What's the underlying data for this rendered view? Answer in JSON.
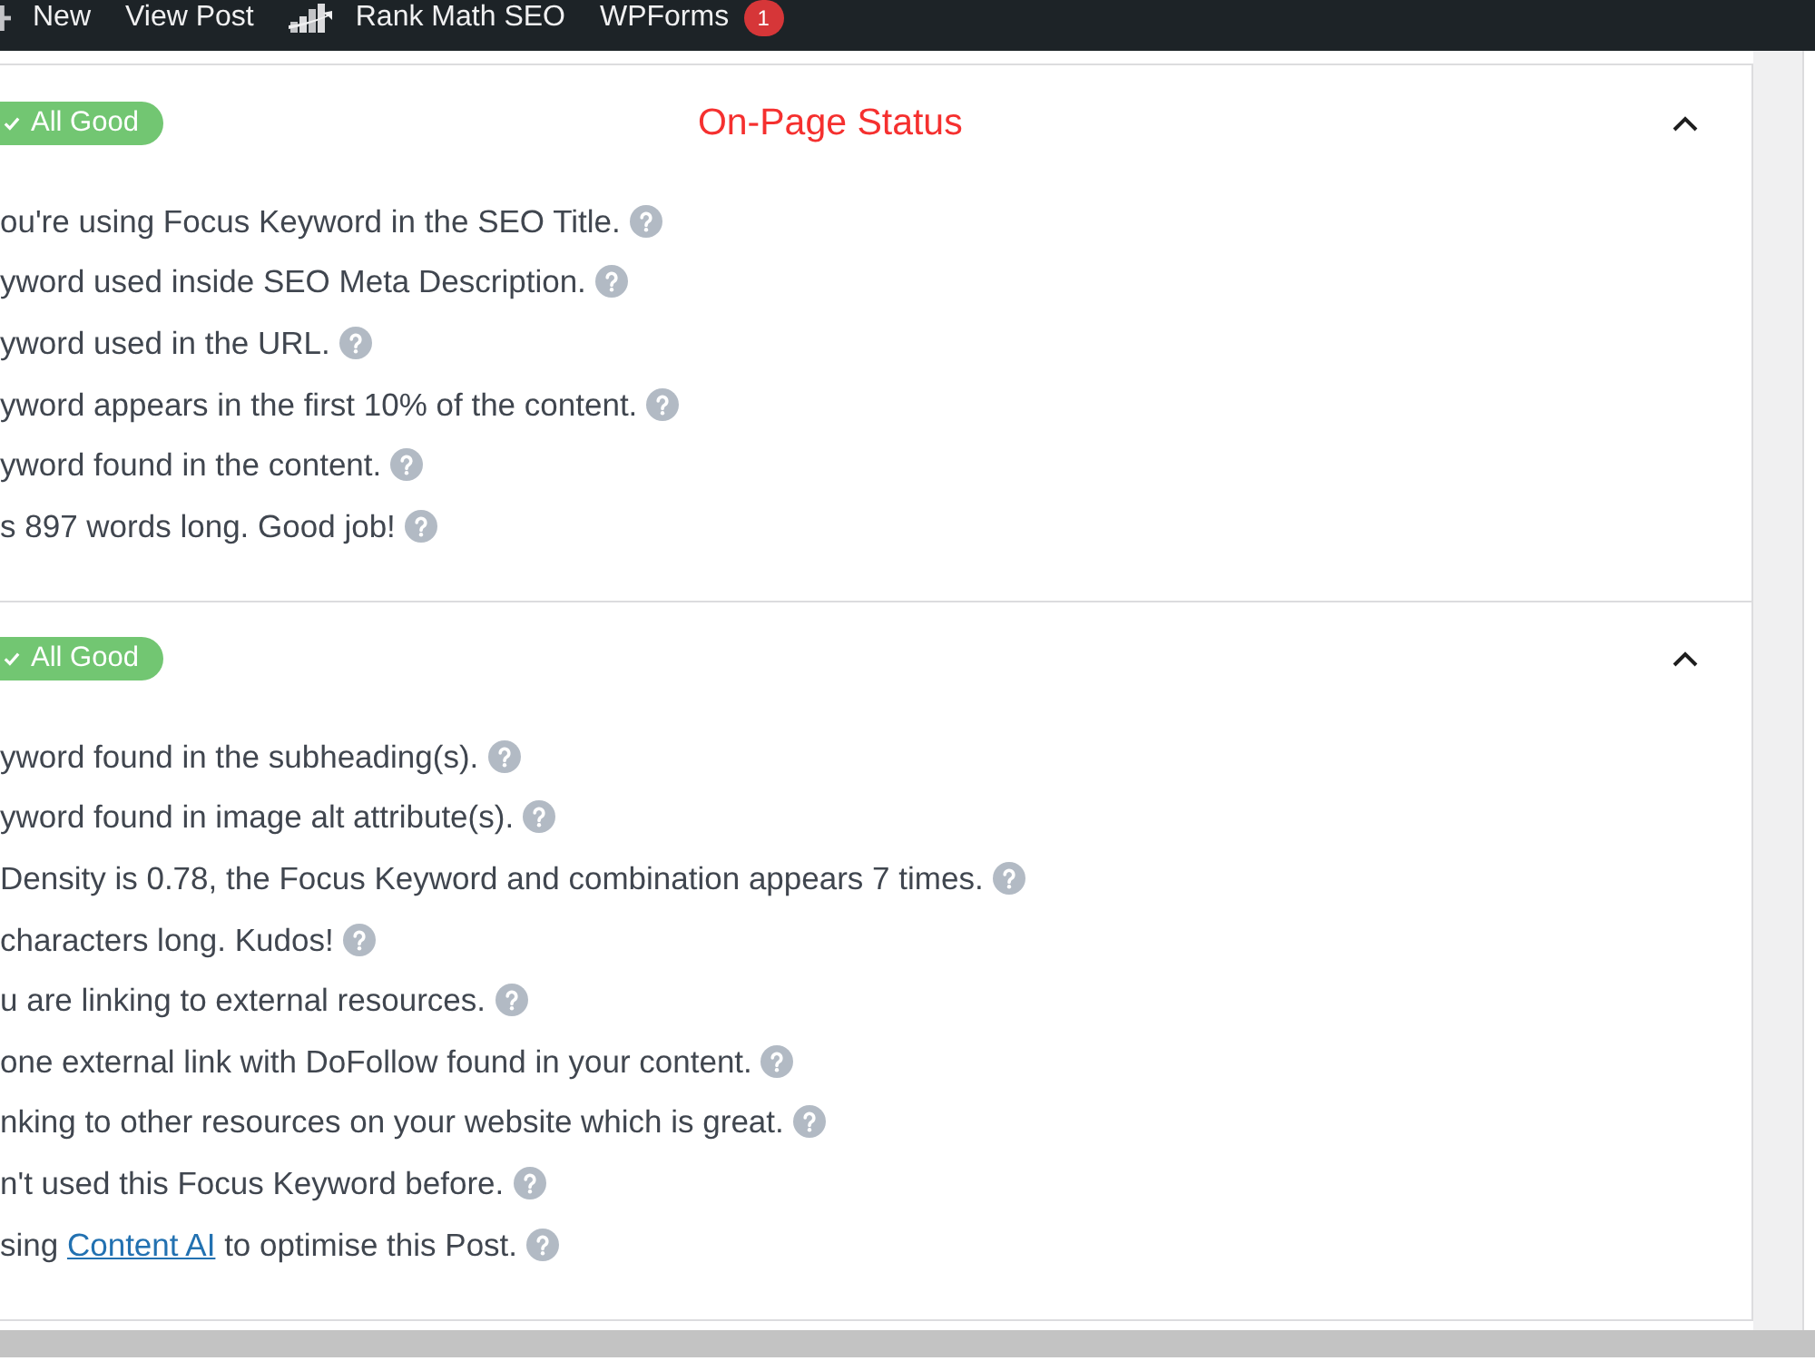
{
  "admin_bar": {
    "items": [
      {
        "kind": "new",
        "label": "New"
      },
      {
        "kind": "link",
        "label": "View Post"
      },
      {
        "kind": "rank-math",
        "label": "Rank Math SEO"
      },
      {
        "kind": "link",
        "label": "WPForms",
        "count": "1"
      }
    ]
  },
  "sections": [
    {
      "passed": true,
      "badge": "All Good",
      "title": "On-Page Status",
      "expanded": true,
      "checks": [
        {
          "text": "ou're using Focus Keyword in the SEO Title."
        },
        {
          "text": "yword used inside SEO Meta Description."
        },
        {
          "text": "yword used in the URL."
        },
        {
          "text": "yword appears in the first 10% of the content."
        },
        {
          "text": "yword found in the content."
        },
        {
          "text": "s 897 words long. Good job!"
        }
      ]
    },
    {
      "passed": true,
      "badge": "All Good",
      "expanded": true,
      "checks": [
        {
          "text": "yword found in the subheading(s)."
        },
        {
          "text": "yword found in image alt attribute(s)."
        },
        {
          "text": "Density is 0.78, the Focus Keyword and combination appears 7 times."
        },
        {
          "text": "characters long. Kudos!"
        },
        {
          "text": "u are linking to external resources."
        },
        {
          "text": "one external link with DoFollow found in your content."
        },
        {
          "text": "nking to other resources on your website which is great."
        },
        {
          "text": "n't used this Focus Keyword before."
        },
        {
          "text": "sing ",
          "link": "Content AI",
          "text_after": " to optimise this Post."
        }
      ]
    }
  ]
}
